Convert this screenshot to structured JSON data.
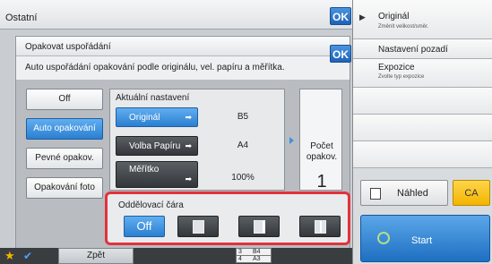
{
  "header": {
    "title": "Ostatní",
    "ok_label": "OK"
  },
  "dialog": {
    "title": "Opakovat uspořádání",
    "ok_label": "OK",
    "description": "Auto uspořádání opakování podle originálu, vel. papíru a měřítka.",
    "modes": [
      {
        "label": "Off",
        "active": false
      },
      {
        "label": "Auto opakování",
        "active": true
      },
      {
        "label": "Pevné opakov.",
        "active": false
      },
      {
        "label": "Opakování foto",
        "active": false
      }
    ],
    "current_settings": {
      "heading": "Aktuální nastavení",
      "rows": [
        {
          "button": "Originál",
          "value": "B5"
        },
        {
          "button": "Volba Papíru",
          "value": "A4"
        },
        {
          "button": "Měřítko",
          "value": "100%"
        }
      ]
    },
    "count": {
      "label_line1": "Počet",
      "label_line2": "opakov.",
      "value": "1"
    },
    "separator": {
      "heading": "Oddělovací čára",
      "off_label": "Off"
    }
  },
  "right_panel": {
    "items": [
      {
        "title": "Originál",
        "subtitle": "Změnit velikost/směr."
      },
      {
        "title": "Nastavení pozadí",
        "subtitle": ""
      },
      {
        "title": "Expozice",
        "subtitle": "Zvolte typ expozice"
      }
    ],
    "preview_label": "Náhled",
    "ca_label": "CA",
    "start_label": "Start"
  },
  "bottom": {
    "back_label": "Zpět",
    "trays": [
      {
        "num": "3",
        "size": "B4"
      },
      {
        "num": "4",
        "size": "A3"
      }
    ]
  },
  "colors": {
    "accent_blue": "#2b7fd1",
    "highlight_red": "#e2323c",
    "ca_yellow": "#f4b400"
  }
}
